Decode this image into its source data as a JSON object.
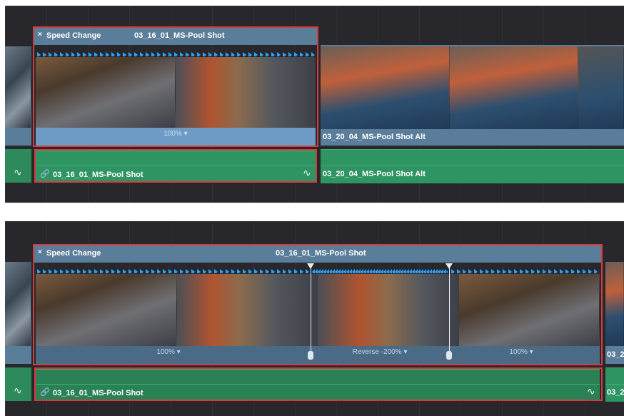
{
  "top": {
    "clip_header_title": "Speed Change",
    "clip_header_name": "03_16_01_MS-Pool Shot",
    "speed_label": "100% ▾",
    "next_clip_name": "03_20_04_MS-Pool Shot Alt",
    "audio_clip_name": "03_16_01_MS-Pool Shot",
    "next_audio_name": "03_20_04_MS-Pool Shot Alt"
  },
  "bottom": {
    "clip_header_title": "Speed Change",
    "clip_header_name": "03_16_01_MS-Pool Shot",
    "speed_label_1": "100% ▾",
    "speed_label_2": "Reverse -200% ▾",
    "speed_label_3": "100% ▾",
    "next_clip_name": "03_2",
    "audio_clip_name": "03_16_01_MS-Pool Shot",
    "next_audio_name": "03_2"
  },
  "icons": {
    "close": "×",
    "link": "🔗",
    "curve": "∿"
  },
  "colors": {
    "video_track": "#5a7d99",
    "audio_track": "#2e9462",
    "selection": "#d43c3c",
    "speed_arrow": "#2aa3ff"
  }
}
